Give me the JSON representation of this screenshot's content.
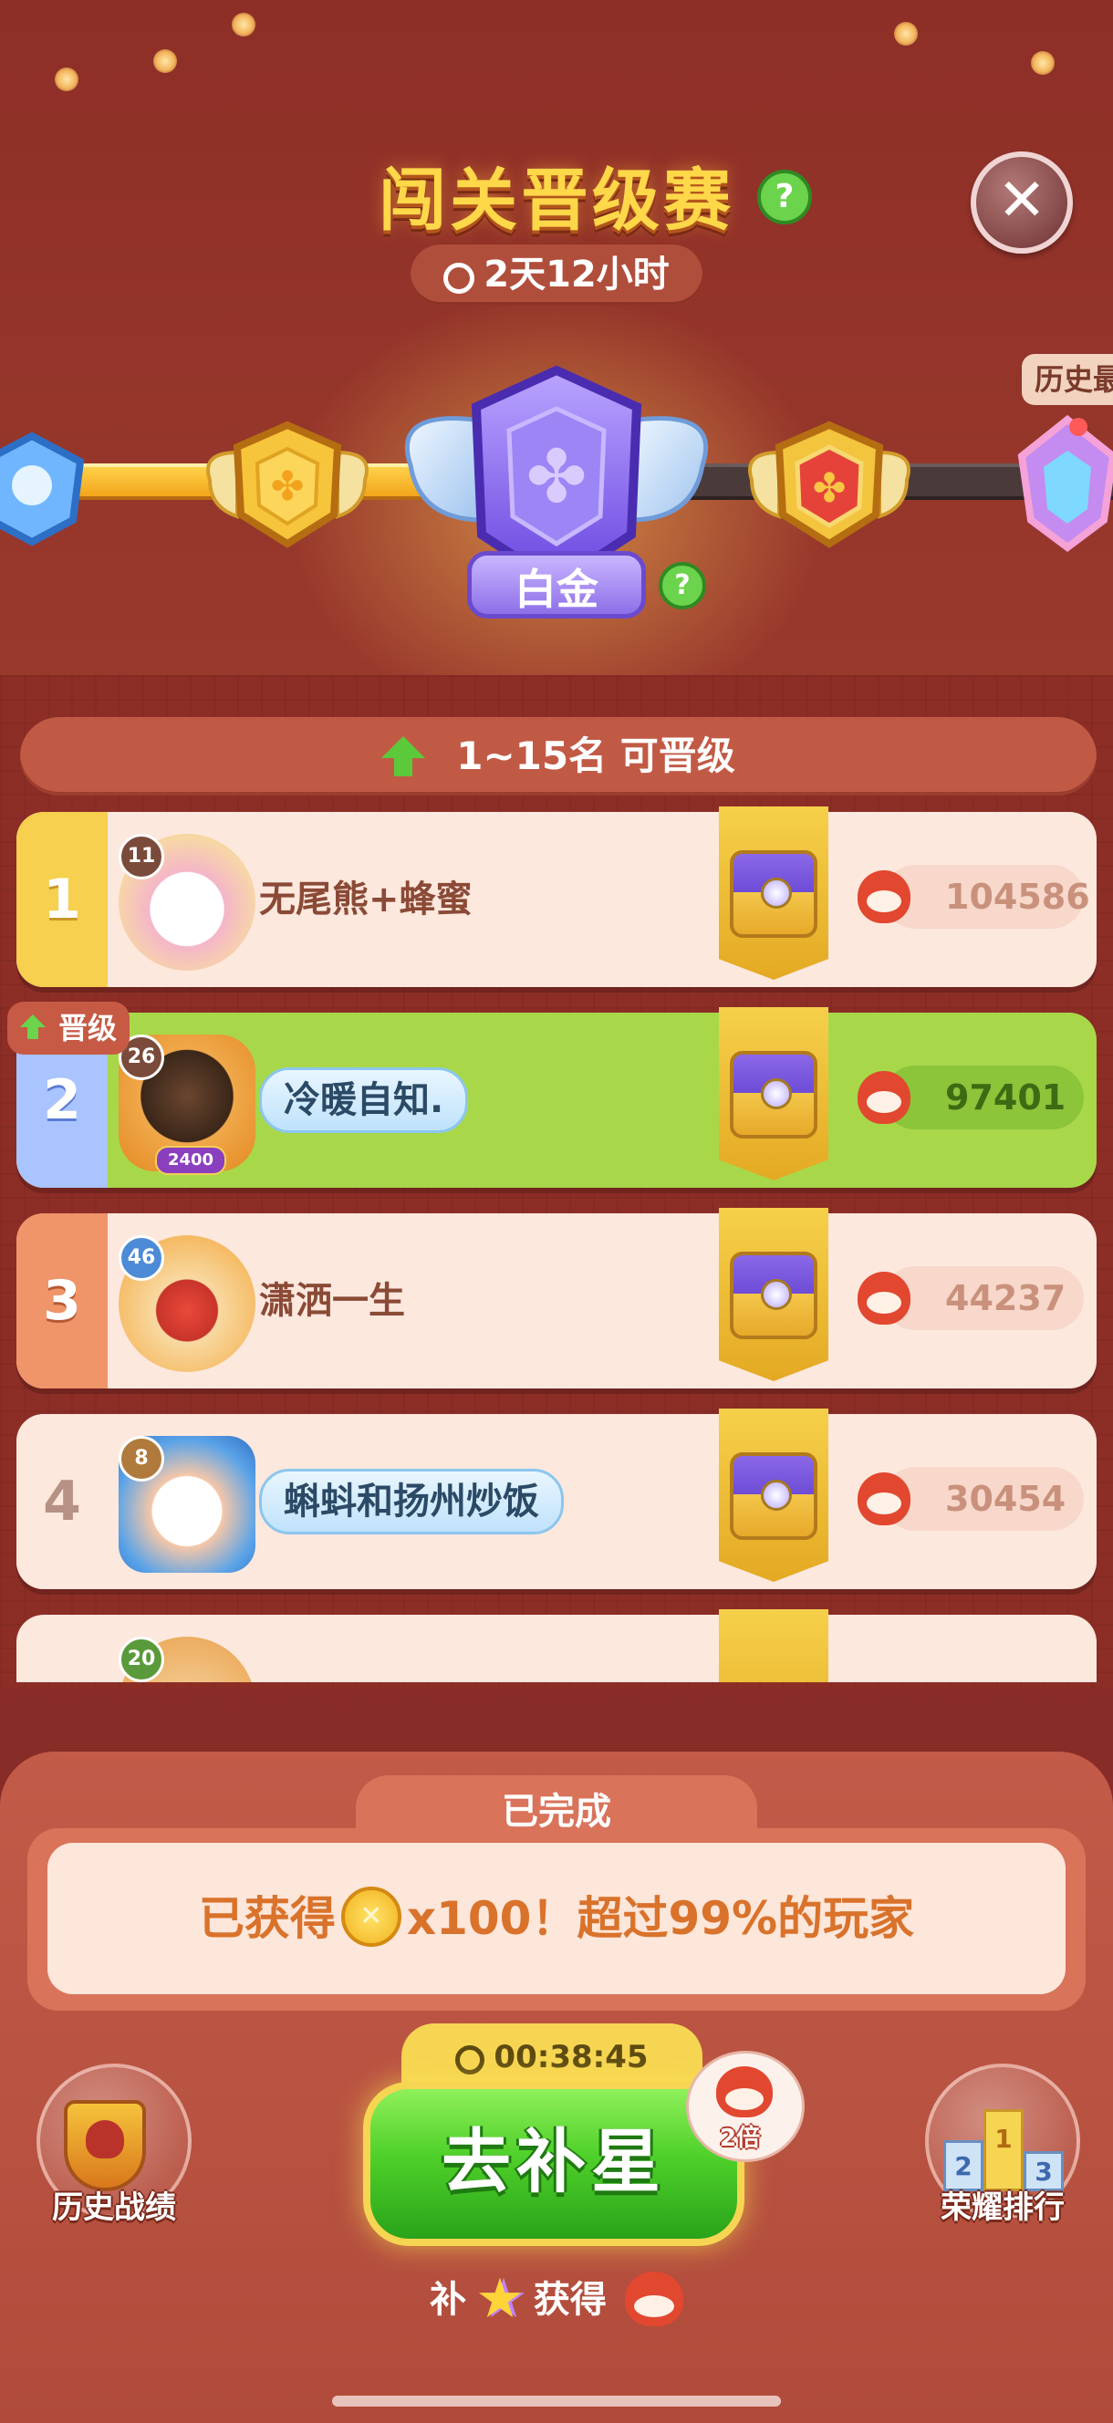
{
  "header": {
    "title": "闯关晋级赛",
    "countdown": "2天12小时"
  },
  "tier": {
    "current_label": "白金",
    "history_tag": "历史最"
  },
  "promotion": {
    "text": "1~15名  可晋级",
    "promote_tag": "晋级"
  },
  "leaderboard": [
    {
      "rank": "1",
      "level": "11",
      "name": "无尾熊+蜂蜜",
      "score": "104586"
    },
    {
      "rank": "2",
      "level": "26",
      "name": "冷暖自知.",
      "score": "97401",
      "avatar_badge": "2400"
    },
    {
      "rank": "3",
      "level": "46",
      "name": "潇洒一生",
      "score": "44237"
    },
    {
      "rank": "4",
      "level": "8",
      "name": "蝌蚪和扬州炒饭",
      "score": "30454"
    },
    {
      "rank": "",
      "level": "20",
      "name": "",
      "score": ""
    }
  ],
  "completion": {
    "tab_label": "已完成",
    "reward_prefix": "已获得",
    "reward_amount": "x100",
    "reward_suffix": "！超过99%的玩家"
  },
  "actions": {
    "history_label": "历史战绩",
    "rank_label": "荣耀排行",
    "go_timer": "00:38:45",
    "go_button": "去补星",
    "double_label": "2倍",
    "note_prefix": "补",
    "note_middle": "获得"
  },
  "colors": {
    "background": "#8a2b24",
    "accent_gold": "#ffd84a",
    "highlight_green": "#a8d84a",
    "button_green": "#4fd02a"
  }
}
